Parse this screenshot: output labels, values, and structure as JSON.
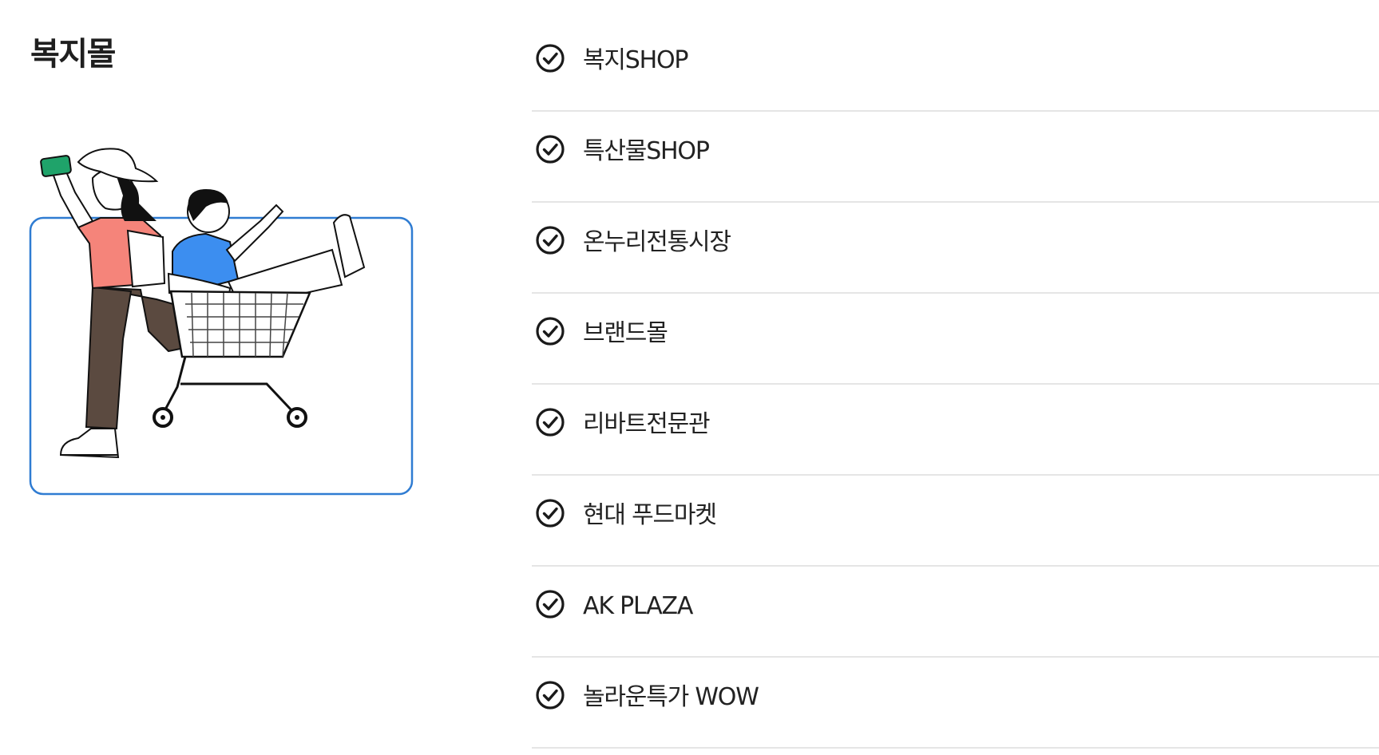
{
  "section": {
    "title": "복지몰"
  },
  "illustration": {
    "icon": "shopping-cart-illustration",
    "frame_color": "#2f7cd2"
  },
  "menu": {
    "check_icon": "check-circle-icon",
    "items": [
      {
        "label": "복지SHOP"
      },
      {
        "label": "특산물SHOP"
      },
      {
        "label": "온누리전통시장"
      },
      {
        "label": "브랜드몰"
      },
      {
        "label": "리바트전문관"
      },
      {
        "label": "현대 푸드마켓"
      },
      {
        "label": "AK PLAZA"
      },
      {
        "label": "놀라운특가 WOW"
      }
    ]
  }
}
